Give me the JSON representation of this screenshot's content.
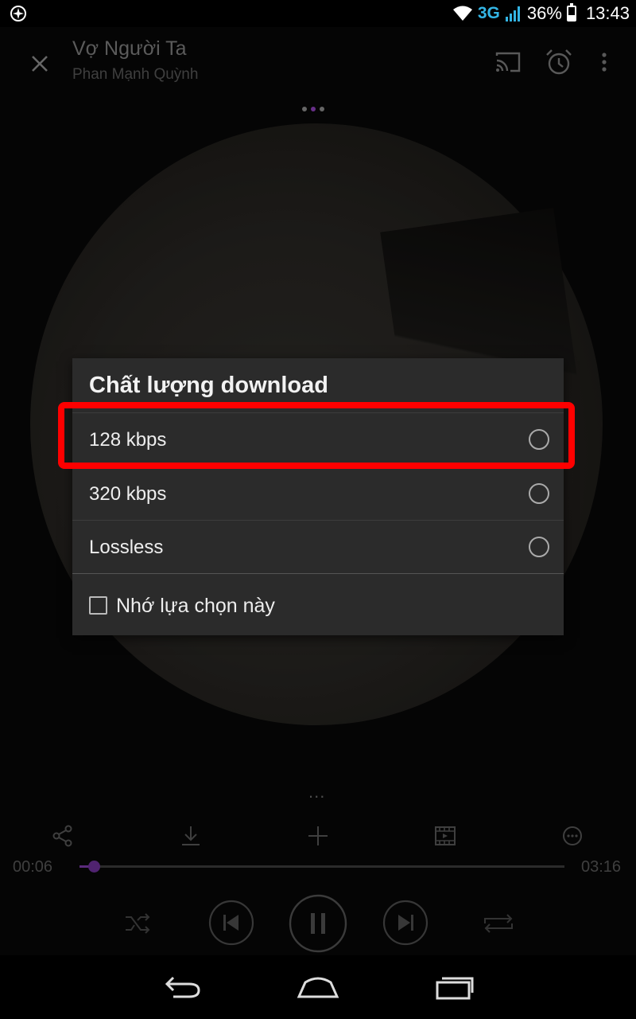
{
  "status_bar": {
    "network": "3G",
    "battery": "36%",
    "battery_level": 0.36,
    "time": "13:43",
    "left_icon": "app-notification-icon"
  },
  "player": {
    "title": "Vợ Người Ta",
    "artist": "Phan Mạnh Quỳnh",
    "header_icons": [
      "close-icon",
      "cast-icon",
      "alarm-clock-icon",
      "more-vert-icon"
    ],
    "page_indicator": {
      "count": 3,
      "active": 1
    },
    "lyrics_more": "...",
    "actions": [
      "share-icon",
      "download-icon",
      "add-icon",
      "video-icon",
      "more-horizontal-icon"
    ],
    "elapsed": "00:06",
    "duration": "03:16",
    "progress": 0.03,
    "controls": [
      "shuffle-icon",
      "previous-icon",
      "pause-icon",
      "next-icon",
      "repeat-icon"
    ],
    "accent_color": "#7a3aa6"
  },
  "dialog": {
    "title": "Chất lượng download",
    "options": [
      {
        "label": "128 kbps",
        "selected": false
      },
      {
        "label": "320 kbps",
        "selected": false
      },
      {
        "label": "Lossless",
        "selected": false
      }
    ],
    "remember_label": "Nhớ lựa chọn này",
    "remember_checked": false,
    "highlight_color": "#ff0000"
  },
  "nav_bar": [
    "back-icon",
    "home-icon",
    "recent-apps-icon"
  ]
}
